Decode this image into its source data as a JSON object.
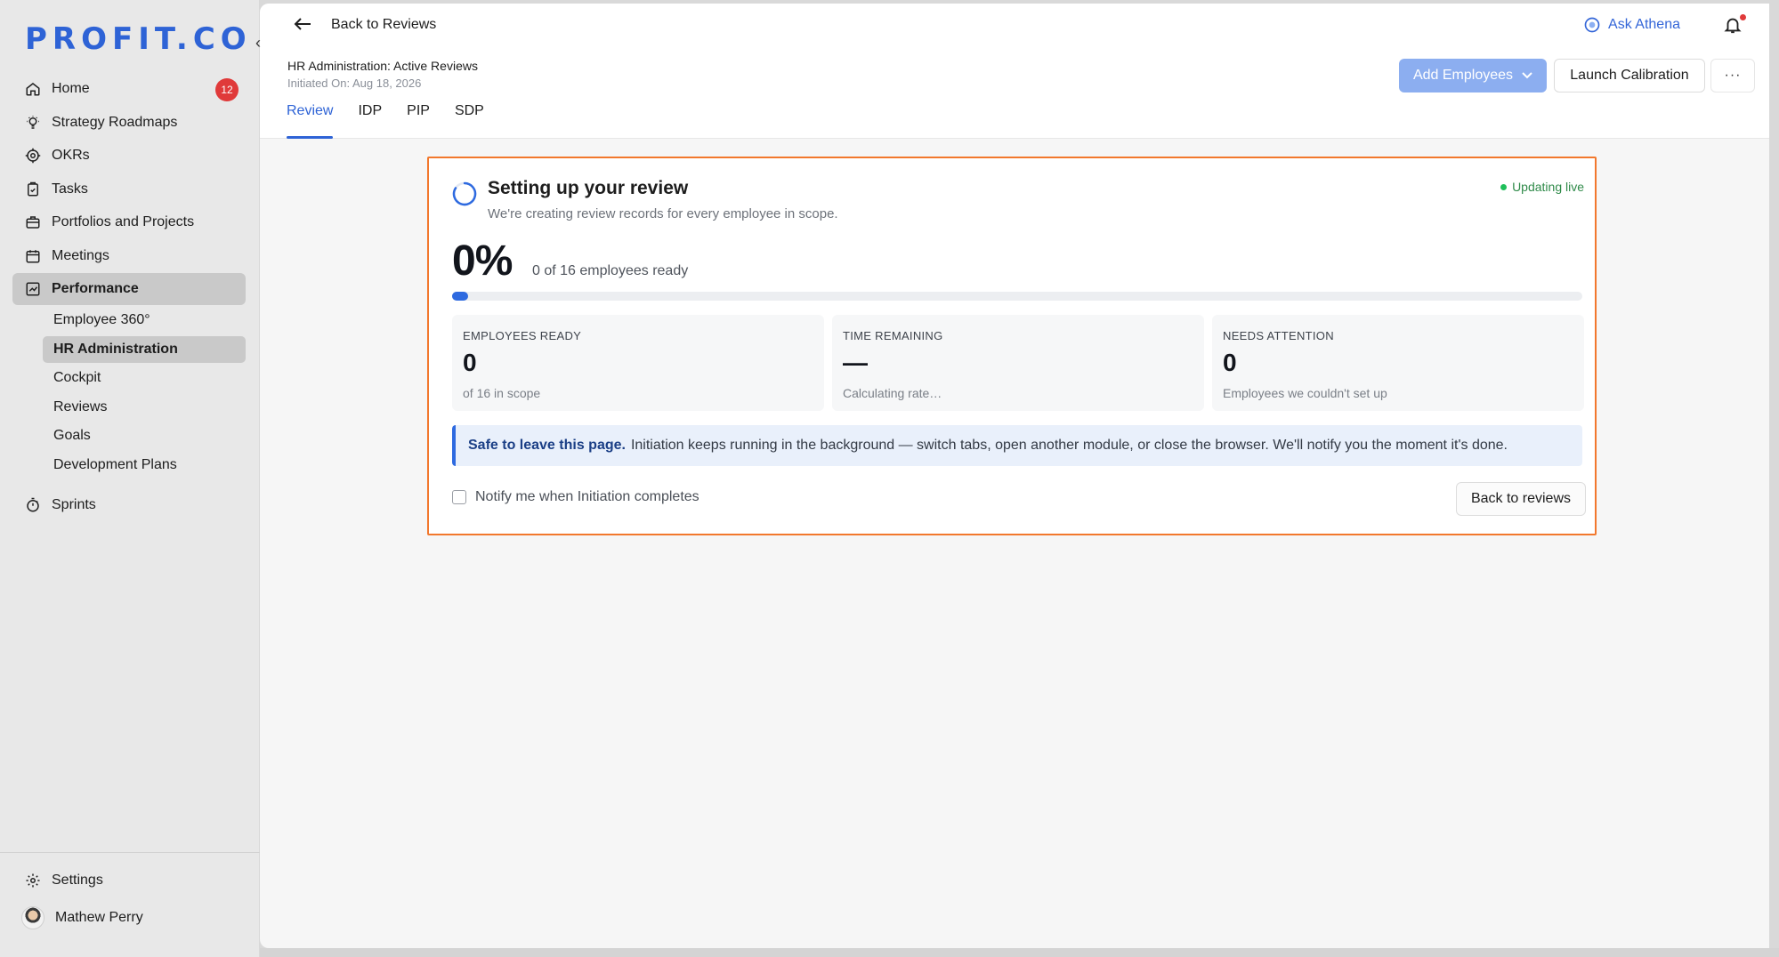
{
  "brand": {
    "logo_text": "PROFIT.CO",
    "accent": "#2e63d6"
  },
  "sidebar": {
    "collapse_glyph": "‹",
    "items": [
      {
        "label": "Home",
        "icon": "home-icon",
        "badge": "12"
      },
      {
        "label": "Strategy Roadmaps",
        "icon": "bulb-icon"
      },
      {
        "label": "OKRs",
        "icon": "target-icon"
      },
      {
        "label": "Tasks",
        "icon": "clipboard-icon"
      },
      {
        "label": "Portfolios and Projects",
        "icon": "briefcase-icon"
      },
      {
        "label": "Meetings",
        "icon": "calendar-icon"
      },
      {
        "label": "Performance",
        "icon": "chart-icon",
        "active": true
      }
    ],
    "performance_sub": [
      {
        "label": "Employee 360°"
      },
      {
        "label": "HR Administration",
        "active": true
      },
      {
        "label": "Cockpit"
      },
      {
        "label": "Reviews"
      },
      {
        "label": "Goals"
      },
      {
        "label": "Development Plans"
      }
    ],
    "sprints": {
      "label": "Sprints",
      "icon": "stopwatch-icon"
    },
    "footer": {
      "settings": "Settings",
      "user_name": "Mathew Perry"
    }
  },
  "topbar": {
    "back_label": "Back to Reviews",
    "ask_athena": "Ask Athena"
  },
  "header": {
    "title": "HR Administration: Active Reviews",
    "initiated": "Initiated On: Aug 18, 2026",
    "tabs": [
      "Review",
      "IDP",
      "PIP",
      "SDP"
    ],
    "active_tab": "Review",
    "add_employees": "Add Employees",
    "launch_calibration": "Launch Calibration",
    "more": "···"
  },
  "setup": {
    "title": "Setting up your review",
    "subtitle": "We're creating review records for every employee in scope.",
    "live_status": "Updating live",
    "percent": "0%",
    "progress_fraction": 0,
    "percent_sub": "0 of 16 employees ready",
    "stats": [
      {
        "label": "EMPLOYEES READY",
        "value": "0",
        "note": "of 16 in scope"
      },
      {
        "label": "TIME REMAINING",
        "value": "—",
        "note": "Calculating rate…"
      },
      {
        "label": "NEEDS ATTENTION",
        "value": "0",
        "note": "Employees we couldn't set up"
      }
    ],
    "notice_bold": "Safe to leave this page.",
    "notice_text": "Initiation keeps running in the background — switch tabs, open another module, or close the browser. We'll notify you the moment it's done.",
    "notify_label": "Notify me when Initiation completes",
    "back_button": "Back to reviews"
  },
  "colors": {
    "highlight_border": "#f2782d",
    "progress": "#2e6ae0",
    "badge": "#e03a3a",
    "live_dot": "#1fbf5a"
  }
}
